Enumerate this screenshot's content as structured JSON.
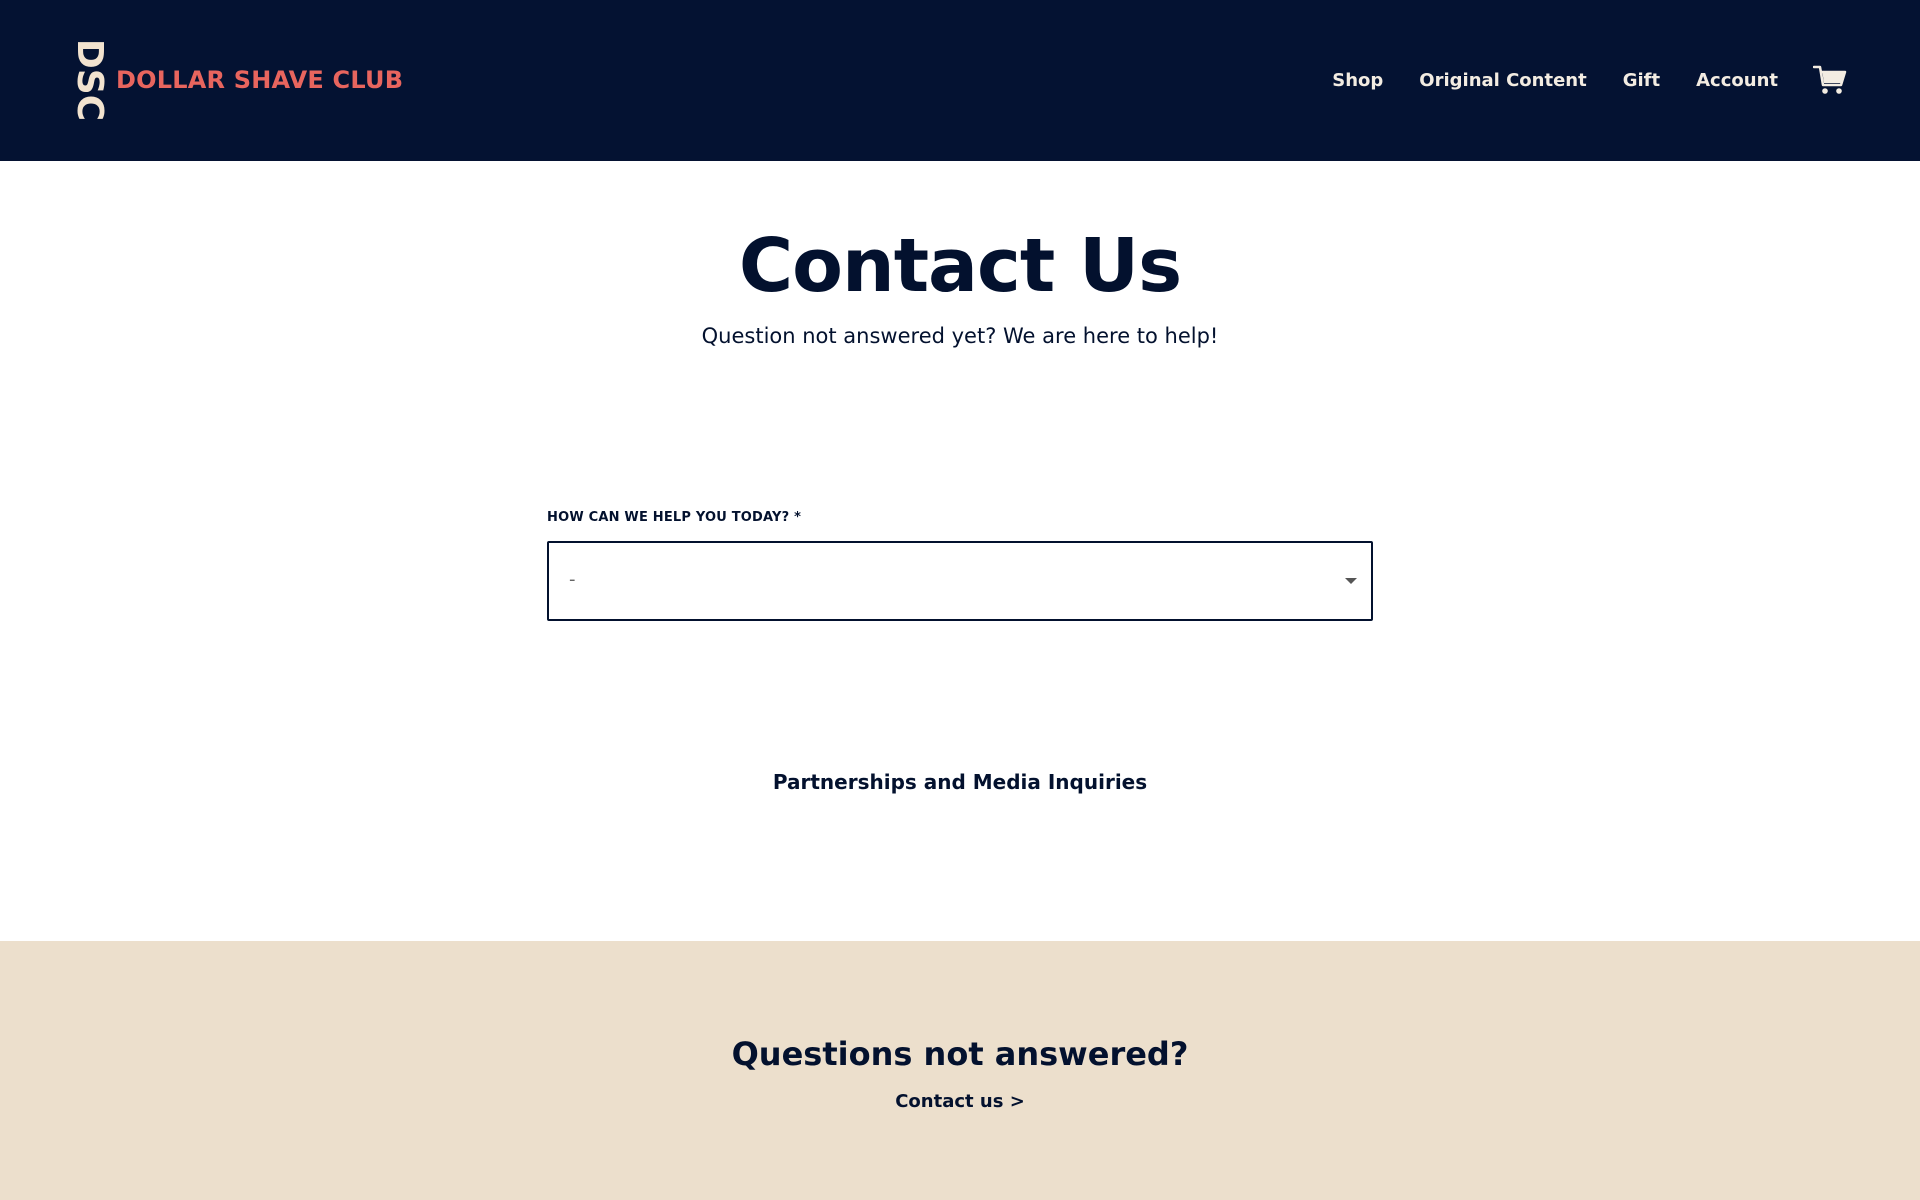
{
  "header": {
    "logo_mark": "DSC",
    "logo_text": "DOLLAR SHAVE CLUB",
    "nav": [
      {
        "label": "Shop"
      },
      {
        "label": "Original Content"
      },
      {
        "label": "Gift"
      },
      {
        "label": "Account"
      }
    ],
    "cart_icon": "cart-icon"
  },
  "main": {
    "title": "Contact Us",
    "subtitle": "Question not answered yet? We are here to help!",
    "help_field": {
      "label": "HOW CAN WE HELP YOU TODAY? *",
      "selected_value": "-"
    },
    "partnerships_link": "Partnerships and Media Inquiries"
  },
  "footer_band": {
    "title": "Questions not answered?",
    "link": "Contact us >"
  },
  "colors": {
    "header_bg": "#041232",
    "brand_red": "#e8655e",
    "logo_cream": "#f2e3cf",
    "text_navy": "#03112e",
    "footer_bg": "#ecdfcc"
  }
}
